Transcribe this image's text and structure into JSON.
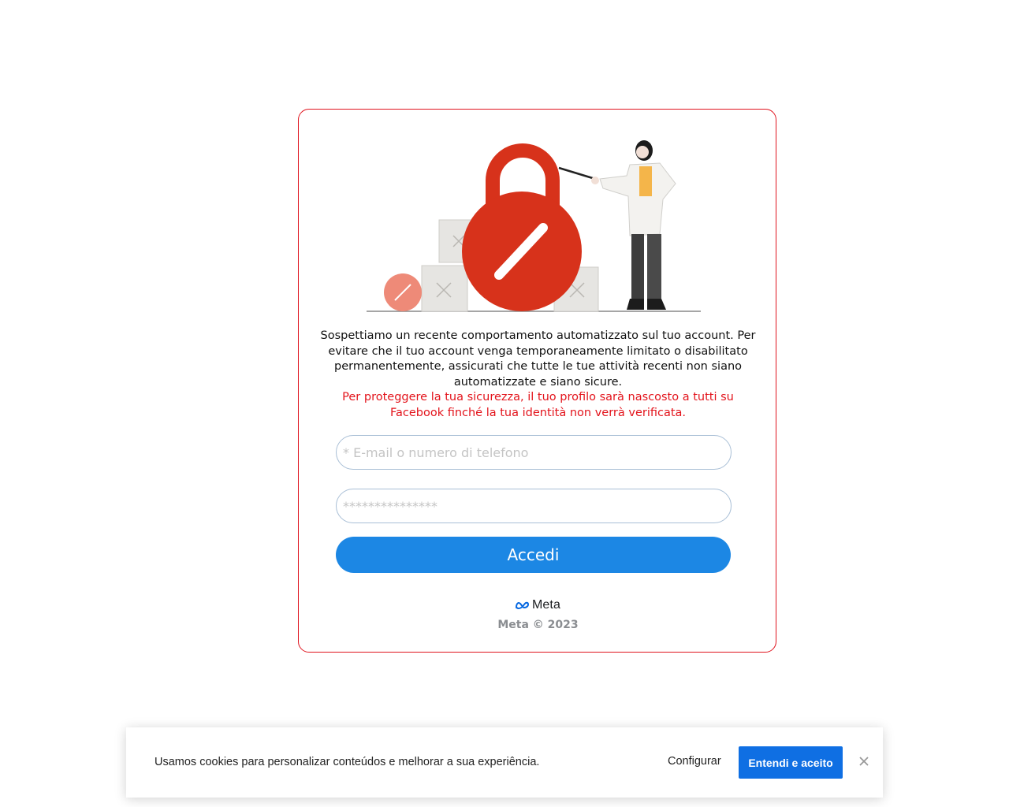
{
  "card": {
    "message": "Sospettiamo un recente comportamento automatizzato sul tuo account. Per evitare che il tuo account venga temporaneamente limitato o disabilitato permanentemente, assicurati che tutte le tue attività recenti non siano automatizzate e siano sicure.",
    "warning": "Per proteggere la tua sicurezza, il tuo profilo sarà nascosto a tutti su Facebook finché la tua identità non verrà verificata.",
    "email_placeholder": "* E-mail o numero di telefono",
    "email_value": "",
    "password_placeholder": "***************",
    "password_value": "",
    "login_label": "Accedi",
    "logo_word": "Meta",
    "copyright": "Meta © 2023"
  },
  "illustration": {
    "icons": [
      "padlock-icon",
      "forbidden-icon",
      "woman-pointing-figure"
    ],
    "accent": "#d7321b",
    "figure_shirt": "#f4b54a"
  },
  "cookie": {
    "text": "Usamos cookies para personalizar conteúdos e melhorar a sua experiência.",
    "configure_label": "Configurar",
    "accept_label": "Entendi e aceito",
    "accent": "#0f6fe3"
  }
}
